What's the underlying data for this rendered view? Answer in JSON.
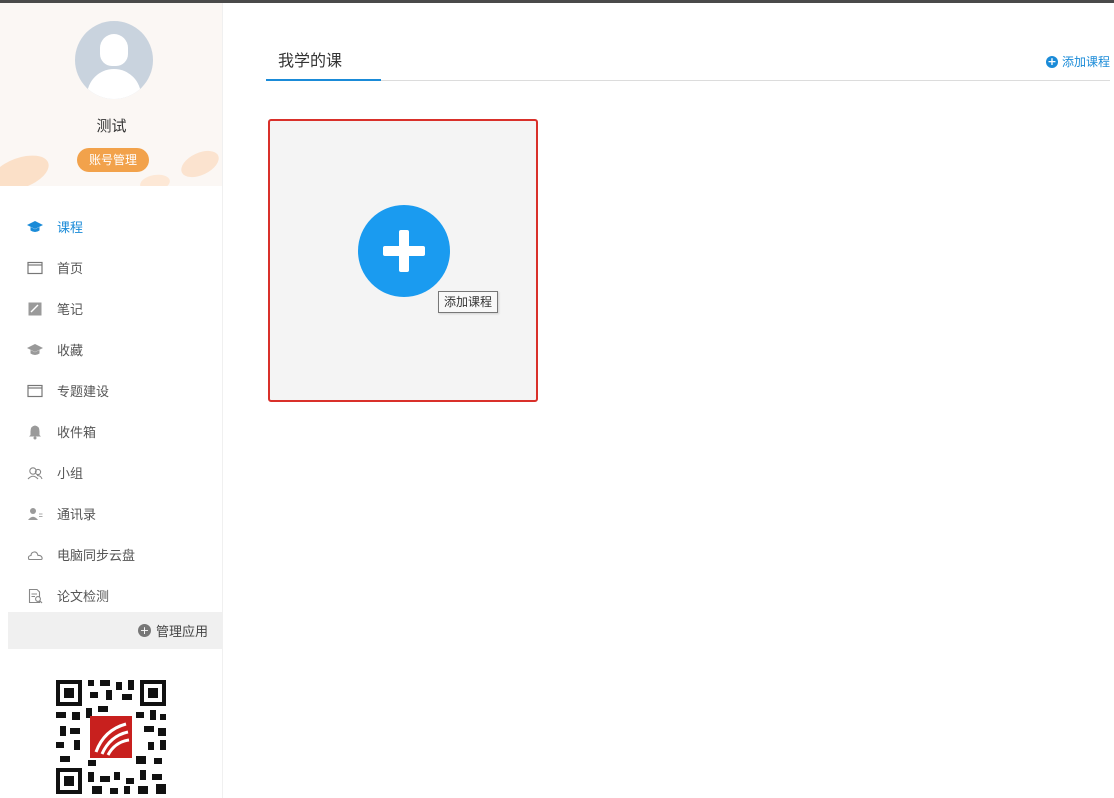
{
  "profile": {
    "username": "测试",
    "account_button": "账号管理"
  },
  "sidebar": {
    "items": [
      {
        "label": "课程",
        "icon": "graduation-cap-icon",
        "active": true
      },
      {
        "label": "首页",
        "icon": "window-icon",
        "active": false
      },
      {
        "label": "笔记",
        "icon": "note-icon",
        "active": false
      },
      {
        "label": "收藏",
        "icon": "graduation-cap-icon",
        "active": false
      },
      {
        "label": "专题建设",
        "icon": "window-icon",
        "active": false
      },
      {
        "label": "收件箱",
        "icon": "bell-icon",
        "active": false
      },
      {
        "label": "小组",
        "icon": "group-icon",
        "active": false
      },
      {
        "label": "通讯录",
        "icon": "contacts-icon",
        "active": false
      },
      {
        "label": "电脑同步云盘",
        "icon": "cloud-icon",
        "active": false
      },
      {
        "label": "论文检测",
        "icon": "document-check-icon",
        "active": false
      }
    ],
    "manage_apps": "管理应用"
  },
  "main": {
    "tab_label": "我学的课",
    "add_course_link": "添加课程",
    "add_card_tooltip": "添加课程"
  },
  "colors": {
    "accent": "#1a8bd8",
    "account_button": "#f2a24b",
    "card_border": "#d9302a",
    "add_circle": "#1a9bf0"
  }
}
